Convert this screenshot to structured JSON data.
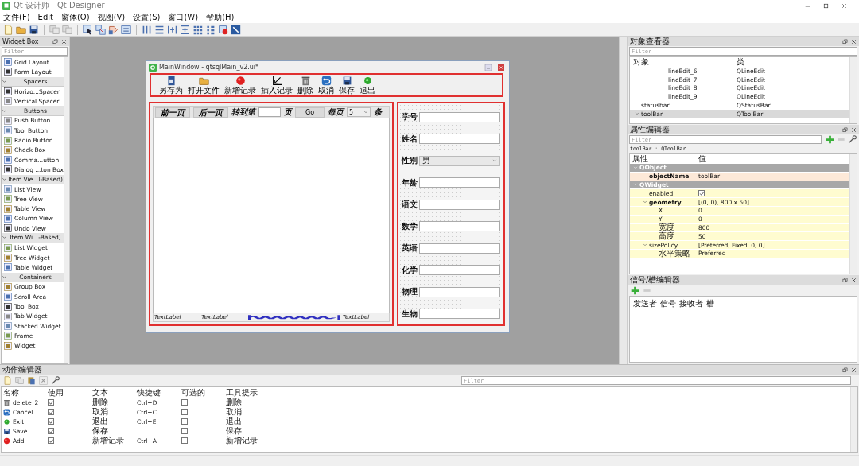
{
  "window": {
    "title": "Qt 设计师 - Qt Designer"
  },
  "menu": [
    "文件(F)",
    "Edit",
    "窗体(O)",
    "视图(V)",
    "设置(S)",
    "窗口(W)",
    "帮助(H)"
  ],
  "widget_box": {
    "title": "Widget Box",
    "filter": {
      "placeholder": "Filter"
    },
    "sections": [
      {
        "items": [
          "Grid Layout",
          "Form Layout"
        ]
      },
      {
        "label": "Spacers",
        "expanded": true,
        "items": [
          "Horizo...Spacer",
          "Vertical Spacer"
        ]
      },
      {
        "label": "Buttons",
        "expanded": true,
        "items": [
          "Push Button",
          "Tool Button",
          "Radio Button",
          "Check Box",
          "Comma...utton",
          "Dialog ...ton Box"
        ]
      },
      {
        "label": "Item Vie...l-Based)",
        "expanded": true,
        "items": [
          "List View",
          "Tree View",
          "Table View",
          "Column View",
          "Undo View"
        ]
      },
      {
        "label": "Item Wi...-Based)",
        "expanded": true,
        "items": [
          "List Widget",
          "Tree Widget",
          "Table Widget"
        ]
      },
      {
        "label": "Containers",
        "expanded": true,
        "items": [
          "Group Box",
          "Scroll Area",
          "Tool Box",
          "Tab Widget",
          "Stacked Widget",
          "Frame",
          "Widget"
        ]
      }
    ]
  },
  "form_window": {
    "title": "MainWindow - qtsqlMain_v2.ui*",
    "toolbar": [
      "另存为",
      "打开文件",
      "新增记录",
      "插入记录",
      "删除",
      "取消",
      "保存",
      "退出"
    ],
    "pager": {
      "prev": "前一页",
      "next": "后一页",
      "goto": "转到第",
      "page_unit": "页",
      "go": "Go",
      "per_page": "每页",
      "per_page_value": "5",
      "unit": "条"
    },
    "status_items": [
      {
        "kind": "label",
        "text": "TextLabel"
      },
      {
        "kind": "label",
        "text": "TextLabel"
      },
      {
        "kind": "spacer"
      },
      {
        "kind": "label",
        "text": "TextLabel"
      }
    ],
    "fields": [
      {
        "label": "学号",
        "kind": "line_edit"
      },
      {
        "label": "姓名",
        "kind": "line_edit"
      },
      {
        "label": "性别",
        "kind": "combo",
        "value": "男"
      },
      {
        "label": "年龄",
        "kind": "line_edit"
      },
      {
        "label": "语文",
        "kind": "line_edit"
      },
      {
        "label": "数学",
        "kind": "line_edit"
      },
      {
        "label": "英语",
        "kind": "line_edit"
      },
      {
        "label": "化学",
        "kind": "line_edit"
      },
      {
        "label": "物理",
        "kind": "line_edit"
      },
      {
        "label": "生物",
        "kind": "line_edit"
      }
    ]
  },
  "object_inspector": {
    "title": "对象查看器",
    "filter": {
      "placeholder": "Filter"
    },
    "columns": [
      "对象",
      "类"
    ],
    "rows": [
      {
        "children": [
          {
            "children": [
              {
                "name": "lineEdit_6",
                "class": "QLineEdit",
                "selected": false
              },
              {
                "name": "lineEdit_7",
                "class": "QLineEdit",
                "selected": false
              },
              {
                "name": "lineEdit_8",
                "class": "QLineEdit",
                "selected": false
              },
              {
                "name": "lineEdit_9",
                "class": "QLineEdit",
                "selected": false
              }
            ]
          }
        ]
      },
      {
        "name": "statusbar",
        "class": "QStatusBar",
        "selected": false
      },
      {
        "name": "toolBar",
        "class": "QToolBar",
        "selected": true,
        "expanded": true
      }
    ]
  },
  "property_editor": {
    "title": "属性编辑器",
    "filter": {
      "placeholder": "Filter"
    },
    "context": "toolBar : QToolBar",
    "columns": [
      "属性",
      "值"
    ],
    "groups": [
      {
        "name": "QObject",
        "expanded": true,
        "properties": [
          {
            "name": "objectName",
            "kind": "text",
            "value": "toolBar",
            "modified": true
          }
        ]
      },
      {
        "name": "QWidget",
        "expanded": true,
        "properties": [
          {
            "name": "enabled",
            "kind": "checkbox",
            "checked": true,
            "modified": false
          },
          {
            "name": "geometry",
            "kind": "text",
            "value": "[(0, 0), 800 x 50]",
            "modified": true,
            "expanded": true,
            "children": [
              {
                "name": "X",
                "kind": "text",
                "value": "0",
                "modified": false
              },
              {
                "name": "Y",
                "kind": "text",
                "value": "0",
                "modified": false
              },
              {
                "name": "宽度",
                "kind": "text",
                "value": "800",
                "modified": false
              },
              {
                "name": "高度",
                "kind": "text",
                "value": "50",
                "modified": false
              }
            ]
          },
          {
            "name": "sizePolicy",
            "kind": "text",
            "value": "[Preferred, Fixed, 0, 0]",
            "modified": false,
            "expanded": true,
            "children": [
              {
                "name": "水平策略",
                "kind": "text",
                "value": "Preferred",
                "modified": false
              }
            ]
          }
        ]
      }
    ]
  },
  "signal_slot_editor": {
    "title": "信号/槽编辑器",
    "columns": [
      "发送者",
      "信号",
      "接收者",
      "槽"
    ]
  },
  "action_editor": {
    "title": "动作编辑器",
    "filter": {
      "placeholder": "Filter"
    },
    "columns": [
      "名称",
      "使用",
      "文本",
      "快捷键",
      "可选的",
      "工具提示"
    ],
    "rows": [
      {
        "name": "delete_2",
        "used": true,
        "text": "删除",
        "shortcut": "Ctrl+D",
        "checkable": false,
        "tooltip": "删除"
      },
      {
        "name": "Cancel",
        "used": true,
        "text": "取消",
        "shortcut": "Ctrl+C",
        "checkable": false,
        "tooltip": "取消"
      },
      {
        "name": "Exit",
        "used": true,
        "text": "退出",
        "shortcut": "Ctrl+E",
        "checkable": false,
        "tooltip": "退出"
      },
      {
        "name": "Save",
        "used": true,
        "text": "保存",
        "checkable": false,
        "tooltip": "保存"
      },
      {
        "name": "Add",
        "used": true,
        "text": "新增记录",
        "shortcut": "Ctrl+A",
        "checkable": false,
        "tooltip": "新增记录"
      }
    ]
  }
}
